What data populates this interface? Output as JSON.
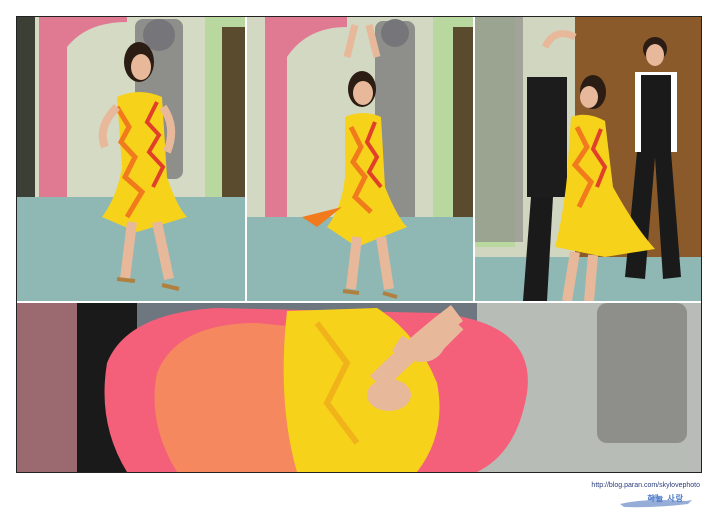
{
  "credit": {
    "url": "http://blog.paran.com/skylovephoto",
    "logo_text": "하늘 사랑"
  },
  "colors": {
    "dress_yellow": "#f7d21a",
    "dress_orange": "#f07a1c",
    "dress_red": "#e0402a",
    "skirt_pink": "#f4607a",
    "floor": "#8fb8b4",
    "wall": "#cfd6c0",
    "arch_pink": "#e07a92",
    "arch_green": "#b8d8a0"
  }
}
